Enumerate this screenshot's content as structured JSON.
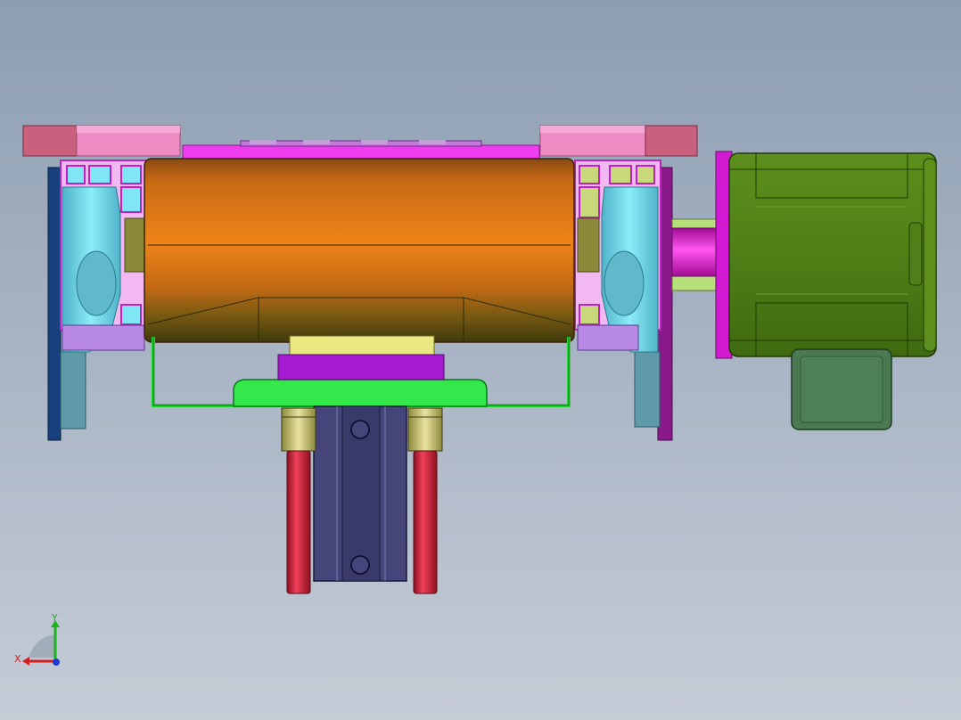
{
  "viewport": {
    "background_top": "#8d9db2",
    "background_bottom": "#c5ccd6"
  },
  "model": {
    "parts": [
      {
        "name": "drive-roller",
        "color": "#e07c16"
      },
      {
        "name": "gear-motor",
        "color": "#4f7f16"
      },
      {
        "name": "motor-terminal-box",
        "color": "#4b7a52"
      },
      {
        "name": "motor-shaft",
        "color": "#e612d6"
      },
      {
        "name": "aluminium-profile-frame",
        "color": "#f03df0"
      },
      {
        "name": "bearing-block",
        "color": "#7fe6f5"
      },
      {
        "name": "side-plate",
        "color": "#17407c"
      },
      {
        "name": "mounting-bracket",
        "color": "#33e84a"
      },
      {
        "name": "cylinder-block",
        "color": "#45457a"
      },
      {
        "name": "guide-rod",
        "color": "#d9263e"
      },
      {
        "name": "linear-bushing",
        "color": "#d9d07a"
      },
      {
        "name": "top-pad",
        "color": "#f08cc4"
      }
    ]
  },
  "triad": {
    "x_label": "X",
    "y_label": "Y",
    "x_color": "#d21e1e",
    "y_color": "#1db31d",
    "z_color": "#1e3ad2"
  }
}
